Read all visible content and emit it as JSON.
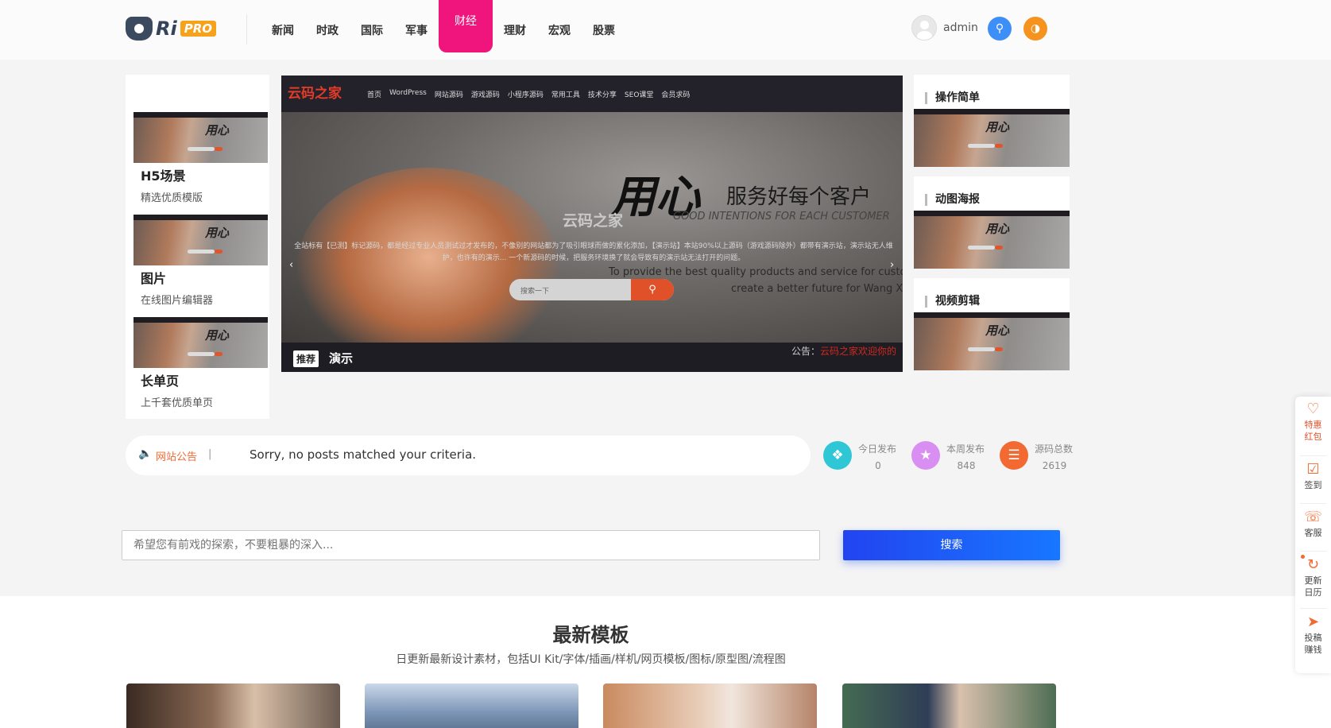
{
  "header": {
    "logo_main": "Ri",
    "logo_badge": "PRO",
    "nav": [
      "新闻",
      "时政",
      "国际",
      "军事",
      "财经",
      "理财",
      "宏观",
      "股票"
    ],
    "active_nav": "财经",
    "username": "admin",
    "search_icon": "search-icon",
    "theme_icon": "theme-toggle-icon"
  },
  "left_items": [
    {
      "title": "H5场景",
      "subtitle": "精选优质模版"
    },
    {
      "title": "图片",
      "subtitle": "在线图片编辑器"
    },
    {
      "title": "长单页",
      "subtitle": "上千套优质单页"
    }
  ],
  "slider": {
    "site_logo": "云码之家",
    "menu": [
      "首页",
      "WordPress",
      "网站源码",
      "游戏源码",
      "小程序源码",
      "常用工具",
      "技术分享",
      "SEO课堂",
      "会员求码"
    ],
    "headline": "用心",
    "slogan": "服务好每个客户",
    "slogan_en": "GOOD INTENTIONS FOR EACH CUSTOMER",
    "site_name": "云码之家",
    "desc": "全站标有【已测】标记源码，都是经过专业人员测试过才发布的，不像别的网站都为了吸引眼球而做的累化添加，【演示站】本站90%以上源码（游戏源码除外）都带有演示站，演示站无人维护，也许有的演示... 一个新源码的时候，把服务环境换了就会导致有的演示站无法打开的问题。",
    "tagline_en_1": "To provide the best quality products and service for customer",
    "tagline_en_2": "create a better future for Wang Xin",
    "search_placeholder": "搜索一下",
    "badge": "推荐",
    "caption": "演示",
    "notice_prefix": "公告：",
    "notice_text": "云码之家欢迎你的"
  },
  "right_items": [
    {
      "title": "操作简单"
    },
    {
      "title": "动图海报"
    },
    {
      "title": "视频剪辑"
    }
  ],
  "notice": {
    "label": "网站公告",
    "separator": "|",
    "text": "Sorry, no posts matched your criteria."
  },
  "stats": [
    {
      "label": "今日发布",
      "value": "0",
      "color": "#2fc7d6",
      "icon": "layers-icon"
    },
    {
      "label": "本周发布",
      "value": "848",
      "color": "#d98ef1",
      "icon": "star-icon"
    },
    {
      "label": "源码总数",
      "value": "2619",
      "color": "#f26a32",
      "icon": "stack-icon"
    }
  ],
  "search": {
    "placeholder": "希望您有前戏的探索，不要粗暴的深入...",
    "button": "搜索"
  },
  "section": {
    "title": "最新模板",
    "subtitle": "日更新最新设计素材，包括UI Kit/字体/插画/样机/网页模板/图标/原型图/流程图"
  },
  "float_bar": [
    {
      "label": "特惠红包",
      "icon": "gift-icon"
    },
    {
      "label": "签到",
      "icon": "checkin-icon"
    },
    {
      "label": "客服",
      "icon": "headset-icon"
    },
    {
      "label": "更新日历",
      "icon": "refresh-icon"
    },
    {
      "label": "投稿赚钱",
      "icon": "send-icon"
    }
  ]
}
